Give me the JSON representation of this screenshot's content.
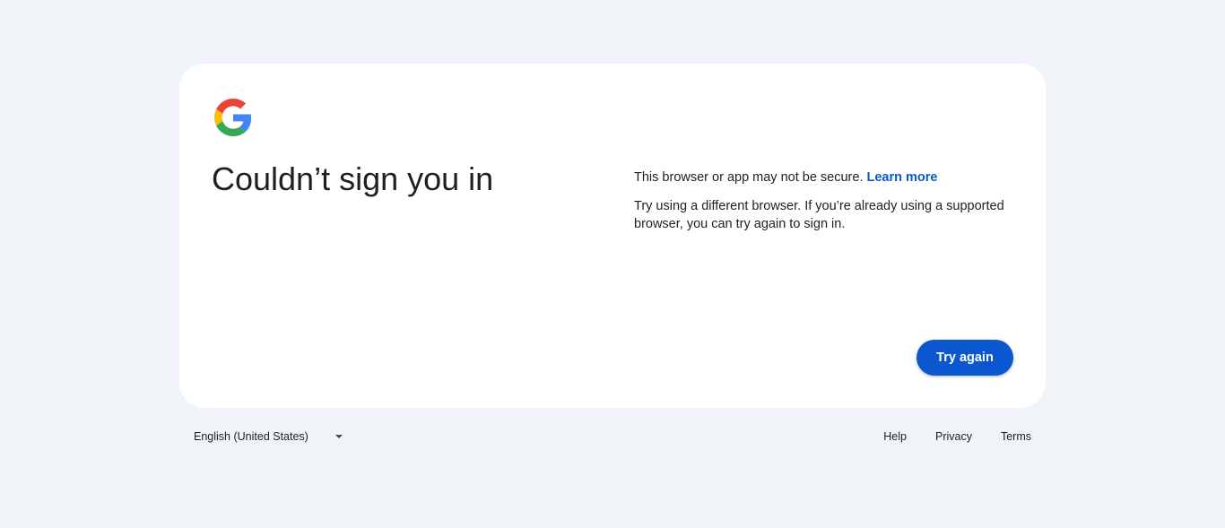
{
  "logo": {
    "icon": "google-g-icon",
    "colors": {
      "blue": "#4285f4",
      "red": "#ea4335",
      "yellow": "#fbbc05",
      "green": "#34a853"
    }
  },
  "headline": "Couldn’t sign you in",
  "message": {
    "line1": "This browser or app may not be secure.",
    "learn_more": "Learn more",
    "line2": "Try using a different browser. If you’re already using a supported browser, you can try again to sign in."
  },
  "actions": {
    "try_again": "Try again"
  },
  "footer": {
    "language": "English (United States)",
    "links": {
      "help": "Help",
      "privacy": "Privacy",
      "terms": "Terms"
    }
  },
  "colors": {
    "background": "#f0f4f9",
    "card": "#ffffff",
    "accent": "#0b57d0",
    "text": "#1f1f1f"
  }
}
